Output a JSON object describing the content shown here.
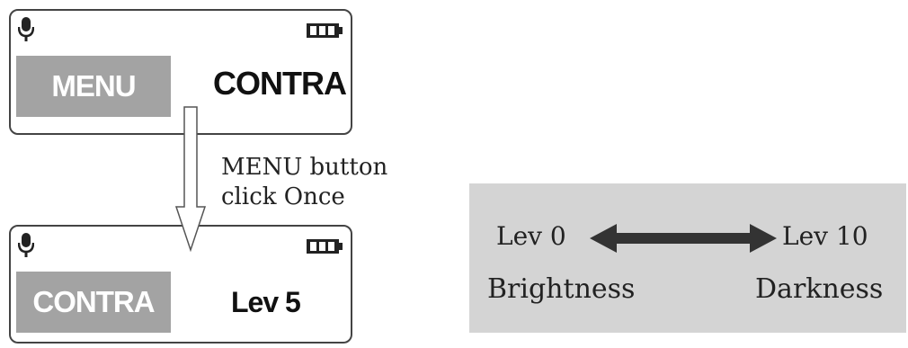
{
  "screens": [
    {
      "left_box": "MENU",
      "right_text": "CONTRA"
    },
    {
      "left_box": "CONTRA",
      "right_text": "Lev 5"
    }
  ],
  "instruction": {
    "line1": "MENU button",
    "line2": "click Once"
  },
  "scale": {
    "min_label": "Lev 0",
    "max_label": "Lev 10",
    "min_meaning": "Brightness",
    "max_meaning": "Darkness"
  },
  "icons": [
    "microphone-icon",
    "battery-icon",
    "down-arrow-icon",
    "double-arrow-icon"
  ],
  "colors": {
    "menu_box": "#a3a3a3",
    "scale_panel": "#d4d4d4",
    "arrow_fill": "#333333"
  }
}
